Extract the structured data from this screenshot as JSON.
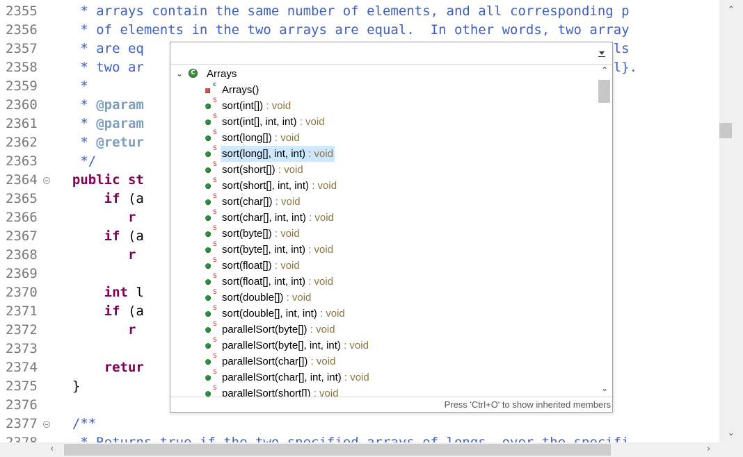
{
  "editor": {
    "lines": [
      {
        "num": "2355",
        "fold": false,
        "segments": [
          {
            "cls": "c-doc",
            "text": "   * arrays contain the same number of elements, and all corresponding p"
          }
        ]
      },
      {
        "num": "2356",
        "fold": false,
        "segments": [
          {
            "cls": "c-doc",
            "text": "   * of elements in the two arrays are equal.  In other words, two array"
          }
        ]
      },
      {
        "num": "2357",
        "fold": false,
        "segments": [
          {
            "cls": "c-doc",
            "text": "   * are eq"
          },
          {
            "cls": "c-doc",
            "text": "                                                  order.  Als"
          }
        ]
      },
      {
        "num": "2358",
        "fold": false,
        "segments": [
          {
            "cls": "c-doc",
            "text": "   * two ar"
          },
          {
            "cls": "c-doc",
            "text": "                                                  @code null}."
          }
        ]
      },
      {
        "num": "2359",
        "fold": false,
        "segments": [
          {
            "cls": "c-doc",
            "text": "   *"
          }
        ]
      },
      {
        "num": "2360",
        "fold": false,
        "segments": [
          {
            "cls": "c-doc",
            "text": "   * "
          },
          {
            "cls": "c-tag",
            "text": "@param"
          }
        ]
      },
      {
        "num": "2361",
        "fold": false,
        "segments": [
          {
            "cls": "c-doc",
            "text": "   * "
          },
          {
            "cls": "c-tag",
            "text": "@param"
          }
        ]
      },
      {
        "num": "2362",
        "fold": false,
        "segments": [
          {
            "cls": "c-doc",
            "text": "   * "
          },
          {
            "cls": "c-tag",
            "text": "@retur"
          }
        ]
      },
      {
        "num": "2363",
        "fold": false,
        "segments": [
          {
            "cls": "c-doc",
            "text": "   */"
          }
        ]
      },
      {
        "num": "2364",
        "fold": true,
        "segments": [
          {
            "cls": "c-kw",
            "text": "  public st"
          }
        ]
      },
      {
        "num": "2365",
        "fold": false,
        "segments": [
          {
            "cls": "c-kw",
            "text": "      if"
          },
          {
            "cls": "c-txt",
            "text": " (a"
          }
        ]
      },
      {
        "num": "2366",
        "fold": false,
        "segments": [
          {
            "cls": "c-kw",
            "text": "         r"
          }
        ]
      },
      {
        "num": "2367",
        "fold": false,
        "segments": [
          {
            "cls": "c-kw",
            "text": "      if"
          },
          {
            "cls": "c-txt",
            "text": " (a"
          }
        ]
      },
      {
        "num": "2368",
        "fold": false,
        "segments": [
          {
            "cls": "c-kw",
            "text": "         r"
          }
        ]
      },
      {
        "num": "2369",
        "fold": false,
        "segments": [
          {
            "cls": "c-txt",
            "text": ""
          }
        ]
      },
      {
        "num": "2370",
        "fold": false,
        "segments": [
          {
            "cls": "c-kw",
            "text": "      int"
          },
          {
            "cls": "c-txt",
            "text": " l"
          }
        ]
      },
      {
        "num": "2371",
        "fold": false,
        "segments": [
          {
            "cls": "c-kw",
            "text": "      if"
          },
          {
            "cls": "c-txt",
            "text": " (a"
          }
        ]
      },
      {
        "num": "2372",
        "fold": false,
        "segments": [
          {
            "cls": "c-kw",
            "text": "         r"
          }
        ]
      },
      {
        "num": "2373",
        "fold": false,
        "segments": [
          {
            "cls": "c-txt",
            "text": ""
          }
        ]
      },
      {
        "num": "2374",
        "fold": false,
        "segments": [
          {
            "cls": "c-kw",
            "text": "      retur"
          }
        ]
      },
      {
        "num": "2375",
        "fold": false,
        "segments": [
          {
            "cls": "c-txt",
            "text": "  }"
          }
        ]
      },
      {
        "num": "2376",
        "fold": false,
        "segments": [
          {
            "cls": "c-txt",
            "text": ""
          }
        ]
      },
      {
        "num": "2377",
        "fold": true,
        "segments": [
          {
            "cls": "c-doc",
            "text": "  /**"
          }
        ]
      },
      {
        "num": "2378",
        "fold": false,
        "segments": [
          {
            "cls": "c-doc",
            "text": "   * Returns true if the two specified arrays of longs, over the specifi"
          }
        ]
      }
    ]
  },
  "outline": {
    "filter_value": "",
    "root": {
      "label": "Arrays",
      "expanded": true
    },
    "members": [
      {
        "name": "Arrays()",
        "type": "",
        "kind": "ctor",
        "badge": "c"
      },
      {
        "name": "sort(int[])",
        "type": " : void",
        "kind": "method",
        "badge": "S"
      },
      {
        "name": "sort(int[], int, int)",
        "type": " : void",
        "kind": "method",
        "badge": "S"
      },
      {
        "name": "sort(long[])",
        "type": " : void",
        "kind": "method",
        "badge": "S"
      },
      {
        "name": "sort(long[], int, int)",
        "type": " : void",
        "kind": "method",
        "badge": "S",
        "selected": true
      },
      {
        "name": "sort(short[])",
        "type": " : void",
        "kind": "method",
        "badge": "S"
      },
      {
        "name": "sort(short[], int, int)",
        "type": " : void",
        "kind": "method",
        "badge": "S"
      },
      {
        "name": "sort(char[])",
        "type": " : void",
        "kind": "method",
        "badge": "S"
      },
      {
        "name": "sort(char[], int, int)",
        "type": " : void",
        "kind": "method",
        "badge": "S"
      },
      {
        "name": "sort(byte[])",
        "type": " : void",
        "kind": "method",
        "badge": "S"
      },
      {
        "name": "sort(byte[], int, int)",
        "type": " : void",
        "kind": "method",
        "badge": "S"
      },
      {
        "name": "sort(float[])",
        "type": " : void",
        "kind": "method",
        "badge": "S"
      },
      {
        "name": "sort(float[], int, int)",
        "type": " : void",
        "kind": "method",
        "badge": "S"
      },
      {
        "name": "sort(double[])",
        "type": " : void",
        "kind": "method",
        "badge": "S"
      },
      {
        "name": "sort(double[], int, int)",
        "type": " : void",
        "kind": "method",
        "badge": "S"
      },
      {
        "name": "parallelSort(byte[])",
        "type": " : void",
        "kind": "method",
        "badge": "S"
      },
      {
        "name": "parallelSort(byte[], int, int)",
        "type": " : void",
        "kind": "method",
        "badge": "S"
      },
      {
        "name": "parallelSort(char[])",
        "type": " : void",
        "kind": "method",
        "badge": "S"
      },
      {
        "name": "parallelSort(char[], int, int)",
        "type": " : void",
        "kind": "method",
        "badge": "S"
      },
      {
        "name": "parallelSort(short[])",
        "type": " : void",
        "kind": "method",
        "badge": "S"
      }
    ],
    "status_text": "Press 'Ctrl+O' to show inherited members"
  },
  "icons": {
    "class_icon": "class-icon",
    "method_icon": "public-method-icon",
    "constructor_icon": "constructor-icon",
    "expand_icon": "chevron-down-icon",
    "menu_icon": "view-menu-icon"
  },
  "colors": {
    "javadoc": "#3f5fbf",
    "javadoc_tag": "#7f9fbf",
    "keyword": "#7f0055",
    "return_type": "#8c7440",
    "selection": "#cde8ff"
  }
}
